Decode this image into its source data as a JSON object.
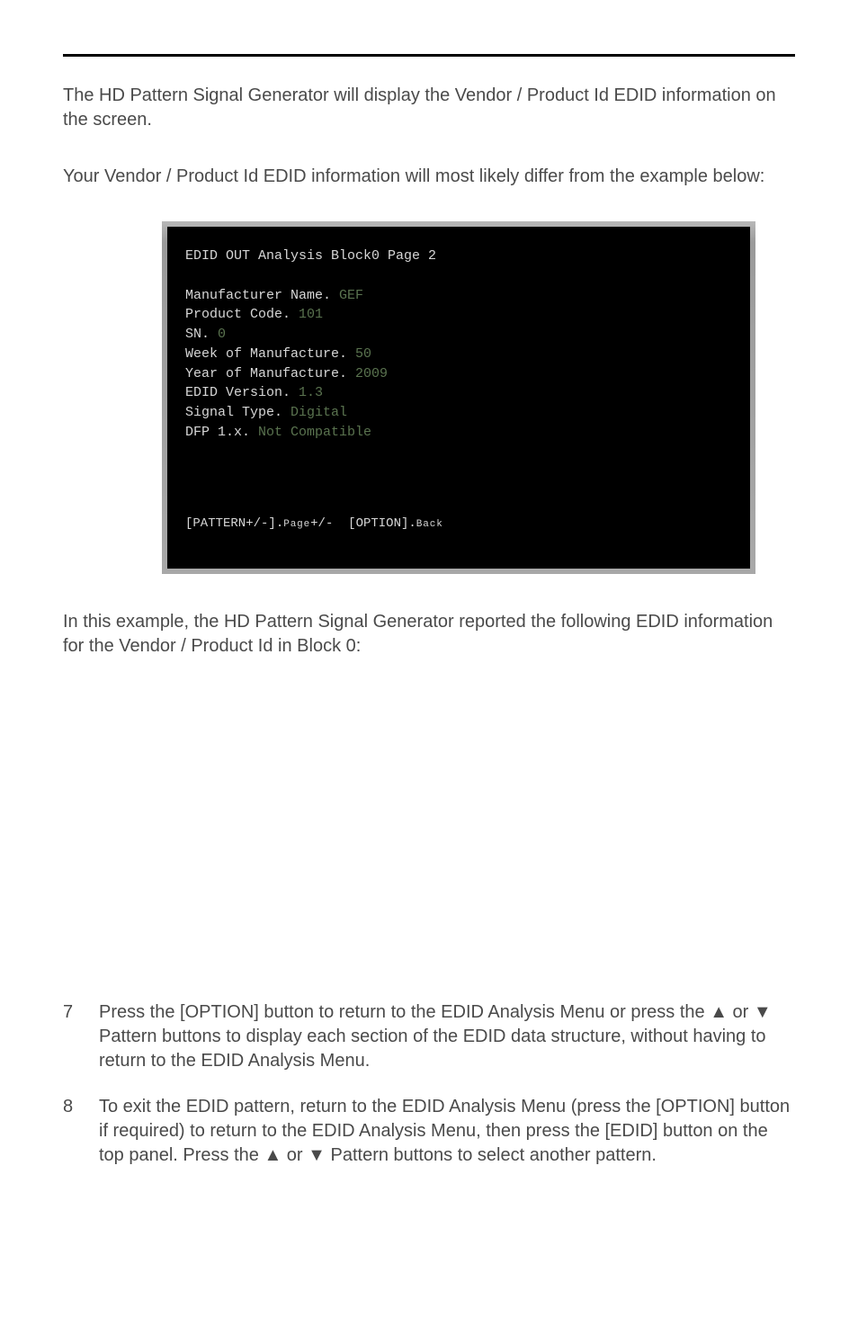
{
  "intro1": "The HD Pattern Signal Generator will display the Vendor / Product Id EDID information on the screen.",
  "intro2": "Your Vendor / Product Id EDID information will most likely differ from the example below:",
  "terminal": {
    "title": "EDID OUT Analysis Block0 Page 2",
    "rows": [
      {
        "label": "Manufacturer Name. ",
        "value": "GEF"
      },
      {
        "label": "Product Code. ",
        "value": "101"
      },
      {
        "label": "SN. ",
        "value": "0"
      },
      {
        "label": "Week of Manufacture. ",
        "value": "50"
      },
      {
        "label": "Year of Manufacture. ",
        "value": "2009"
      },
      {
        "label": "EDID Version. ",
        "value": "1.3"
      },
      {
        "label": "Signal Type. ",
        "value": "Digital"
      },
      {
        "label": "DFP 1.x. ",
        "value": "Not Compatible"
      }
    ],
    "footer_a_pre": "[PATTERN+/-].",
    "footer_a_small": "Page",
    "footer_a_post": "+/-",
    "footer_b_pre": "  [OPTION].",
    "footer_b_small": "Back"
  },
  "after": "In this example, the HD Pattern Signal Generator reported the following EDID information for the Vendor / Product Id in Block 0:",
  "steps": [
    {
      "num": "7",
      "text": "Press the [OPTION] button to return to the EDID Analysis Menu or press the ▲ or ▼ Pattern buttons to display each section of the EDID data structure, without having to return to the EDID Analysis Menu."
    },
    {
      "num": "8",
      "text": "To exit the EDID pattern, return to the EDID Analysis Menu (press the [OPTION] button if required) to return to the EDID Analysis Menu, then press the [EDID] button on the top panel.  Press the ▲ or ▼ Pattern buttons to select another pattern."
    }
  ]
}
